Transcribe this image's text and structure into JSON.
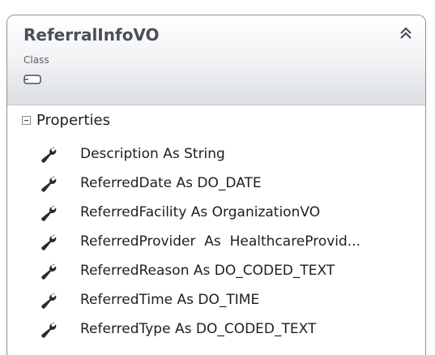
{
  "class_shape": {
    "name": "ReferralInfoVO",
    "stereotype": "Class",
    "collapse_icon": "double-chevron-up-icon"
  },
  "compartment": {
    "label": "Properties",
    "toggle_icon": "minus-box-icon"
  },
  "members": [
    {
      "text": "Description As String",
      "icon": "wrench-icon"
    },
    {
      "text": "ReferredDate As DO_DATE",
      "icon": "wrench-icon"
    },
    {
      "text": "ReferredFacility As OrganizationVO",
      "icon": "wrench-icon"
    },
    {
      "text": "ReferredProvider  As  HealthcareProvid...",
      "icon": "wrench-icon"
    },
    {
      "text": "ReferredReason As DO_CODED_TEXT",
      "icon": "wrench-icon"
    },
    {
      "text": "ReferredTime As DO_TIME",
      "icon": "wrench-icon"
    },
    {
      "text": "ReferredType As DO_CODED_TEXT",
      "icon": "wrench-icon"
    }
  ],
  "colors": {
    "border": "#8e8f8f",
    "title": "#4a4f57",
    "text": "#1e1e1e",
    "icon": "#2b2b2b"
  }
}
